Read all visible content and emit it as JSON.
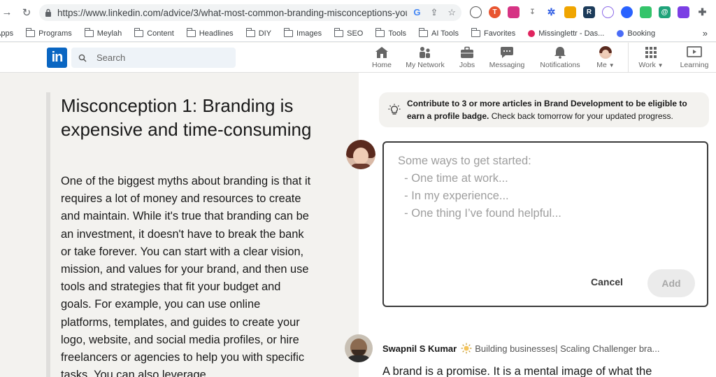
{
  "browser": {
    "url": "https://www.linkedin.com/advice/3/what-most-common-branding-misconceptions-you...",
    "bookmarks": [
      {
        "label": "Apps",
        "folder": false
      },
      {
        "label": "Programs",
        "folder": true
      },
      {
        "label": "Meylah",
        "folder": true
      },
      {
        "label": "Content",
        "folder": true
      },
      {
        "label": "Headlines",
        "folder": true
      },
      {
        "label": "DIY",
        "folder": true
      },
      {
        "label": "Images",
        "folder": true
      },
      {
        "label": "SEO",
        "folder": true
      },
      {
        "label": "Tools",
        "folder": true
      },
      {
        "label": "AI Tools",
        "folder": true
      },
      {
        "label": "Favorites",
        "folder": true
      },
      {
        "label": "Missinglettr - Das...",
        "folder": false
      },
      {
        "label": "Booking",
        "folder": false
      }
    ],
    "bookmarks_more": "»"
  },
  "header": {
    "logo": "in",
    "search_placeholder": "Search",
    "nav": {
      "home": "Home",
      "network": "My Network",
      "jobs": "Jobs",
      "messaging": "Messaging",
      "notifications": "Notifications",
      "me": "Me",
      "work": "Work",
      "learning": "Learning"
    }
  },
  "article": {
    "title": "Misconception 1: Branding is expensive and time-consuming",
    "body": "One of the biggest myths about branding is that it requires a lot of money and resources to create and maintain. While it's true that branding can be an investment, it doesn't have to break the bank or take forever. You can start with a clear vision, mission, and values for your brand, and then use tools and strategies that fit your budget and goals. For example, you can use online platforms, templates, and guides to create your logo, website, and social media profiles, or hire freelancers or agencies to help you with specific tasks. You can also leverage"
  },
  "banner": {
    "bold": "Contribute to 3 or more articles in Brand Development to be eligible to earn a profile badge.",
    "rest": " Check back tomorrow for your updated progress."
  },
  "composer": {
    "placeholder": "Some ways to get started:\n  - One time at work...\n  - In my experience...\n  - One thing I’ve found helpful...",
    "cancel": "Cancel",
    "add": "Add"
  },
  "comment": {
    "author": "Swapnil S Kumar",
    "headline": "Building businesses| Scaling Challenger bra...",
    "text": "A brand is a promise. It is a mental image of what the"
  },
  "colors": {
    "linkedin_blue": "#0a66c2",
    "background": "#f3f2ef"
  }
}
